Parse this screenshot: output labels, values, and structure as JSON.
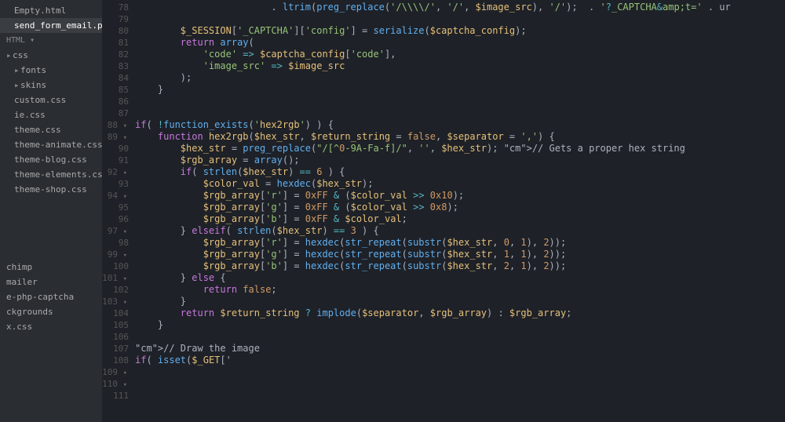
{
  "sidebar": {
    "items": [
      {
        "label": "Empty.html",
        "indent": 1,
        "caret": false
      },
      {
        "label": "send_form_email.php",
        "indent": 1,
        "caret": false,
        "active": true
      }
    ],
    "section": "HTML",
    "tree": [
      {
        "label": "css",
        "indent": 0,
        "caret": true
      },
      {
        "label": "fonts",
        "indent": 1,
        "caret": true
      },
      {
        "label": "skins",
        "indent": 1,
        "caret": true
      },
      {
        "label": "custom.css",
        "indent": 1,
        "caret": false
      },
      {
        "label": "ie.css",
        "indent": 1,
        "caret": false
      },
      {
        "label": "theme.css",
        "indent": 1,
        "caret": false
      },
      {
        "label": "theme-animate.css",
        "indent": 1,
        "caret": false
      },
      {
        "label": "theme-blog.css",
        "indent": 1,
        "caret": false
      },
      {
        "label": "theme-elements.css",
        "indent": 1,
        "caret": false
      },
      {
        "label": "theme-shop.css",
        "indent": 1,
        "caret": false
      }
    ],
    "bottom": [
      {
        "label": "chimp"
      },
      {
        "label": "mailer"
      },
      {
        "label": "e-php-captcha"
      },
      {
        "label": "ckgrounds"
      },
      {
        "label": "x.css"
      }
    ]
  },
  "gutter": {
    "start": 78,
    "end": 111,
    "folds": [
      88,
      89,
      92,
      94,
      97,
      99,
      101,
      103,
      109,
      110
    ]
  },
  "code": {
    "lines": [
      "                        . ltrim(preg_replace('/\\\\\\\\/', '/', $image_src), '/');  . '?_CAPTCHA&amp;t=' . ur",
      "",
      "        $_SESSION['_CAPTCHA']['config'] = serialize($captcha_config);",
      "        return array(",
      "            'code' => $captcha_config['code'],",
      "            'image_src' => $image_src",
      "        );",
      "    }",
      "",
      "",
      "if( !function_exists('hex2rgb') ) {",
      "    function hex2rgb($hex_str, $return_string = false, $separator = ',') {",
      "        $hex_str = preg_replace(\"/[^0-9A-Fa-f]/\", '', $hex_str); // Gets a proper hex string",
      "        $rgb_array = array();",
      "        if( strlen($hex_str) == 6 ) {",
      "            $color_val = hexdec($hex_str);",
      "            $rgb_array['r'] = 0xFF & ($color_val >> 0x10);",
      "            $rgb_array['g'] = 0xFF & ($color_val >> 0x8);",
      "            $rgb_array['b'] = 0xFF & $color_val;",
      "        } elseif( strlen($hex_str) == 3 ) {",
      "            $rgb_array['r'] = hexdec(str_repeat(substr($hex_str, 0, 1), 2));",
      "            $rgb_array['g'] = hexdec(str_repeat(substr($hex_str, 1, 1), 2));",
      "            $rgb_array['b'] = hexdec(str_repeat(substr($hex_str, 2, 1), 2));",
      "        } else {",
      "            return false;",
      "        }",
      "        return $return_string ? implode($separator, $rgb_array) : $rgb_array;",
      "    }",
      "",
      "// Draw the image",
      "if( isset($_GET['"
    ]
  }
}
